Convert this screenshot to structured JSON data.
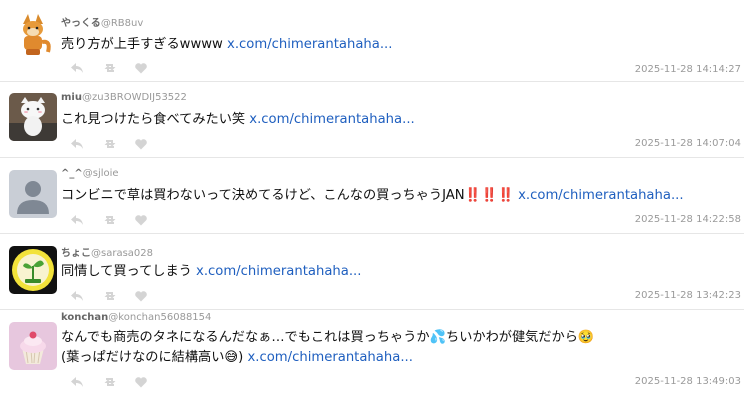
{
  "tweets": [
    {
      "username": "やっくる",
      "handle": "@RB8uv",
      "text": "売り方が上手すぎるwwww ",
      "link": "x.com/chimerantahaha...",
      "timestamp": "2025-11-28 14:14:27",
      "avatar_icon": "fox-figure-avatar"
    },
    {
      "username": "miu",
      "handle": "@zu3BROWDIJ53522",
      "text": "これ見つけたら食べてみたい笑 ",
      "link": "x.com/chimerantahaha...",
      "timestamp": "2025-11-28 14:07:04",
      "avatar_icon": "white-cat-avatar"
    },
    {
      "username": "^_^",
      "handle": "@sjloie",
      "text": "コンビニで草は買わないって決めてるけど、こんなの買っちゃうJAN‼️‼️‼️ ",
      "link": "x.com/chimerantahaha...",
      "timestamp": "2025-11-28 14:22:58",
      "avatar_icon": "default-person-avatar"
    },
    {
      "username": "ちょこ",
      "handle": "@sarasa028",
      "text": "同情して買ってしまう ",
      "link": "x.com/chimerantahaha...",
      "timestamp": "2025-11-28 13:42:23",
      "avatar_icon": "plant-logo-avatar"
    },
    {
      "username": "konchan",
      "handle": "@konchan56088154",
      "text": "なんでも商売のタネになるんだなぁ…でもこれは買っちゃうか💦ちいかわが健気だから🥹",
      "text2": "(葉っぱだけなのに結構高い😅) ",
      "link": "x.com/chimerantahaha...",
      "timestamp": "2025-11-28 13:49:03",
      "avatar_icon": "cupcake-avatar"
    }
  ],
  "actions": {
    "reply_icon": "reply-icon",
    "retweet_icon": "retweet-icon",
    "like_icon": "heart-icon"
  },
  "colors": {
    "link": "#1f5fbf",
    "meta": "#9a9a9a",
    "divider": "#e6e6e6"
  }
}
